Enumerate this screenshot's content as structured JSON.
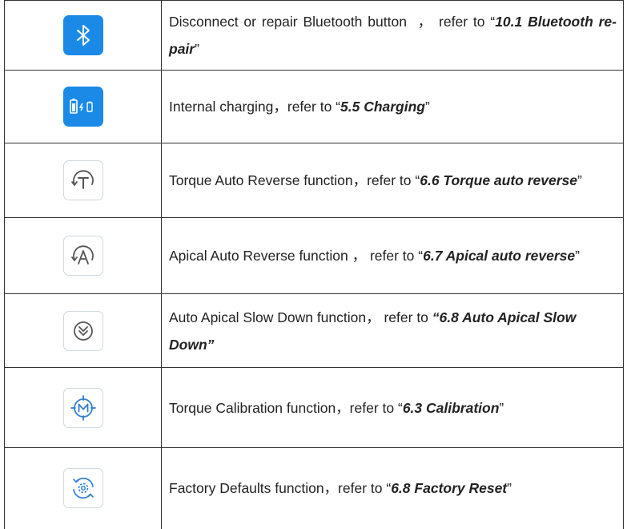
{
  "rows": [
    {
      "icon": "bluetooth-icon",
      "prefix": "Disconnect or repair Bluetooth button  ， refer to “",
      "ref": "10.1 Bluetooth re-pair",
      "suffix": "”"
    },
    {
      "icon": "battery-charging-icon",
      "prefix": "Internal charging，refer to “",
      "ref": "5.5 Charging",
      "suffix": "”"
    },
    {
      "icon": "torque-auto-reverse-icon",
      "prefix": "Torque Auto Reverse function，refer to “",
      "ref": "6.6 Torque auto reverse",
      "suffix": "”"
    },
    {
      "icon": "apical-auto-reverse-icon",
      "prefix": "Apical Auto Reverse function ， refer to “",
      "ref": "6.7 Apical auto reverse",
      "suffix": "”"
    },
    {
      "icon": "apical-slow-down-icon",
      "prefix": "Auto Apical Slow Down function， refer to ",
      "ref": "“6.8 Auto Apical Slow Down”",
      "suffix": ""
    },
    {
      "icon": "torque-calibration-icon",
      "prefix": "Torque Calibration function，refer to “",
      "ref": "6.3 Calibration",
      "suffix": "”"
    },
    {
      "icon": "factory-reset-icon",
      "prefix": "Factory Defaults function，refer to “",
      "ref": "6.8 Factory Reset",
      "suffix": "”"
    }
  ],
  "colors": {
    "icon_blue": "#1a8ae6",
    "icon_outline_stroke": "#2f7fd6",
    "border": "#333333"
  }
}
